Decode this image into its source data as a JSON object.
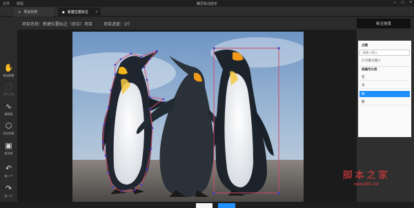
{
  "menubar": {
    "items": [
      "文件",
      "帮助"
    ],
    "title": "精灵标注助手",
    "window_controls": [
      "minimize-icon",
      "maximize-icon",
      "close-icon"
    ]
  },
  "tabs": [
    {
      "label": "项目列表",
      "icon": "home-icon",
      "active": false
    },
    {
      "label": "新建位置标注",
      "icon": "star-icon",
      "active": true,
      "close": "×"
    }
  ],
  "info": {
    "project_label": "项目名称：新建位置标注（综合）项目",
    "progress_label": "项目进度：2/7"
  },
  "panel": {
    "header": "标注信息",
    "group_title": "企鹅",
    "input_placeholder": "请输入输入",
    "checkbox_label": "同意以输入",
    "list_title": "按编号分类",
    "items": [
      "无",
      "鸟",
      "鸭",
      "鹅"
    ],
    "selected_index": 2
  },
  "tools": [
    {
      "label": "移动图像",
      "icon": "hand-icon",
      "enabled": true
    },
    {
      "label": "图片压缩",
      "icon": "crop-icon",
      "enabled": false
    },
    {
      "label": "曲线框",
      "icon": "curve-icon",
      "enabled": true
    },
    {
      "label": "多边形框",
      "icon": "polygon-icon",
      "enabled": true
    },
    {
      "label": "矩形框",
      "icon": "rectangle-icon",
      "enabled": true
    },
    {
      "label": "前一个",
      "icon": "arrow-left-icon",
      "enabled": true
    },
    {
      "label": "后一个",
      "icon": "arrow-right-icon",
      "enabled": true
    }
  ],
  "annotation": {
    "rect_color": "#d04a6a",
    "point_color": "#3a3fd0",
    "polygon_color": "#e04a6a"
  },
  "watermark": {
    "text": "脚本之家",
    "url": "www.jb51.net"
  },
  "colors": {
    "accent": "#1e90ff",
    "background": "#252525"
  }
}
